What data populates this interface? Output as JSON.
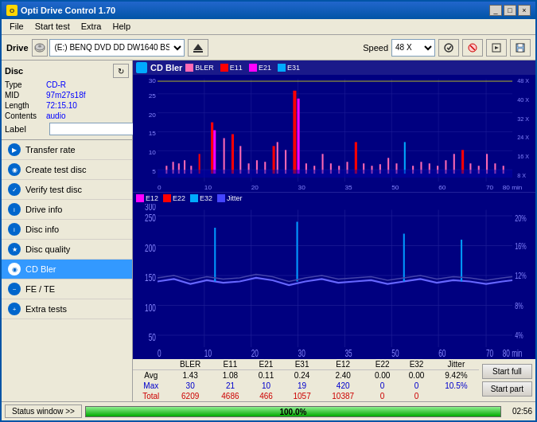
{
  "window": {
    "title": "Opti Drive Control 1.70",
    "controls": [
      "_",
      "□",
      "×"
    ]
  },
  "menu": {
    "items": [
      "File",
      "Start test",
      "Extra",
      "Help"
    ]
  },
  "toolbar": {
    "drive_label": "Drive",
    "drive_value": "(E:)  BENQ DVD DD DW1640 BSRB",
    "speed_label": "Speed",
    "speed_value": "48 X"
  },
  "disc": {
    "title": "Disc",
    "type_label": "Type",
    "type_value": "CD-R",
    "mid_label": "MID",
    "mid_value": "97m27s18f",
    "length_label": "Length",
    "length_value": "72:15.10",
    "contents_label": "Contents",
    "contents_value": "audio",
    "label_label": "Label",
    "label_value": ""
  },
  "nav": {
    "items": [
      {
        "id": "transfer-rate",
        "label": "Transfer rate",
        "active": false
      },
      {
        "id": "create-test-disc",
        "label": "Create test disc",
        "active": false
      },
      {
        "id": "verify-test-disc",
        "label": "Verify test disc",
        "active": false
      },
      {
        "id": "drive-info",
        "label": "Drive info",
        "active": false
      },
      {
        "id": "disc-info",
        "label": "Disc info",
        "active": false
      },
      {
        "id": "disc-quality",
        "label": "Disc quality",
        "active": false
      },
      {
        "id": "cd-bler",
        "label": "CD Bler",
        "active": true
      },
      {
        "id": "fe-te",
        "label": "FE / TE",
        "active": false
      },
      {
        "id": "extra-tests",
        "label": "Extra tests",
        "active": false
      }
    ]
  },
  "chart": {
    "title": "CD Bler",
    "upper_legend": [
      "BLER",
      "E11",
      "E21",
      "E31"
    ],
    "upper_legend_colors": [
      "#ff69b4",
      "#ff0000",
      "#ff00ff",
      "#00aaff"
    ],
    "lower_legend": [
      "E12",
      "E22",
      "E32",
      "Jitter"
    ],
    "lower_legend_colors": [
      "#ff00ff",
      "#ff0000",
      "#00aaff",
      "#4444ff"
    ],
    "upper_y_labels": [
      "30",
      "25",
      "20",
      "15",
      "10",
      "5"
    ],
    "upper_y_right": [
      "48 X",
      "40 X",
      "32 X",
      "24 X",
      "16 X",
      "8 X"
    ],
    "lower_y_labels": [
      "300",
      "250",
      "200",
      "150",
      "100",
      "50"
    ],
    "lower_y_right": [
      "20%",
      "16%",
      "12%",
      "8%",
      "4%"
    ],
    "x_labels": [
      "0",
      "10",
      "20",
      "30",
      "35",
      "50",
      "60",
      "70",
      "80 min"
    ],
    "upper_x_labels_pos": [
      "0",
      "10",
      "20",
      "30",
      "35",
      "50",
      "60",
      "70",
      "80 min"
    ]
  },
  "stats": {
    "headers": [
      "",
      "BLER",
      "E11",
      "E21",
      "E31",
      "E12",
      "E22",
      "E32",
      "Jitter"
    ],
    "rows": [
      {
        "type": "Avg",
        "values": [
          "1.43",
          "1.08",
          "0.11",
          "0.24",
          "2.40",
          "0.00",
          "0.00",
          "9.42%"
        ]
      },
      {
        "type": "Max",
        "values": [
          "30",
          "21",
          "10",
          "19",
          "420",
          "0",
          "0",
          "10.5%"
        ]
      },
      {
        "type": "Total",
        "values": [
          "6209",
          "4686",
          "466",
          "1057",
          "10387",
          "0",
          "0",
          ""
        ]
      }
    ]
  },
  "buttons": {
    "start_full": "Start full",
    "start_part": "Start part"
  },
  "status": {
    "button_label": "Status window >>",
    "progress": "100.0%",
    "progress_value": 100,
    "time": "02:56"
  }
}
